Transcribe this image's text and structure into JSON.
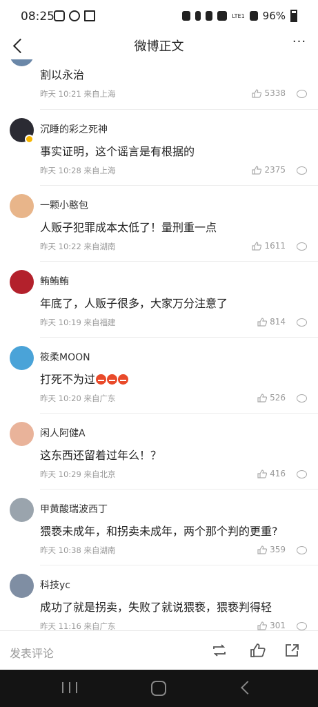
{
  "status_bar": {
    "time": "08:25",
    "battery": "96%",
    "network": "LTE1"
  },
  "header": {
    "title": "微博正文",
    "more": "···"
  },
  "comments": [
    {
      "user": "",
      "text": "割以永治",
      "time": "昨天 10:21",
      "location": "来自上海",
      "likes": "5338"
    },
    {
      "user": "沉睡的彩之死神",
      "text": "事实证明，这个谣言是有根据的",
      "time": "昨天 10:28",
      "location": "来自上海",
      "likes": "2375"
    },
    {
      "user": "一颗小憨包",
      "text": "人贩子犯罪成本太低了！量刑重一点",
      "time": "昨天 10:22",
      "location": "来自湖南",
      "likes": "1611"
    },
    {
      "user": "鲔鲔鲔",
      "text": "年底了，人贩子很多，大家万分注意了",
      "time": "昨天 10:19",
      "location": "来自福建",
      "likes": "814"
    },
    {
      "user": "筱柔MOON",
      "text": "打死不为过",
      "time": "昨天 10:20",
      "location": "来自广东",
      "likes": "526"
    },
    {
      "user": "闲人阿健A",
      "text": "这东西还留着过年么！？",
      "time": "昨天 10:29",
      "location": "来自北京",
      "likes": "416"
    },
    {
      "user": "甲黄酸瑞波西丁",
      "text": "猥亵未成年，和拐卖未成年，两个那个判的更重?",
      "time": "昨天 10:38",
      "location": "来自湖南",
      "likes": "359"
    },
    {
      "user": "科技yc",
      "text": "成功了就是拐卖，失败了就说猥亵，猥亵判得轻",
      "time": "昨天 11:16",
      "location": "来自广东",
      "likes": "301"
    }
  ],
  "bottom_bar": {
    "comment_placeholder": "发表评论"
  },
  "colors": {
    "text": "#222222",
    "meta": "#999999",
    "divider": "#ececec",
    "nav_bg": "#141414"
  }
}
